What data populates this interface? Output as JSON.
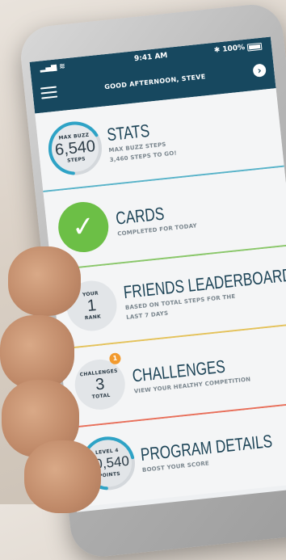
{
  "status_bar": {
    "time": "9:41 AM",
    "battery": "100%"
  },
  "header": {
    "greeting": "GOOD AFTERNOON, STEVE"
  },
  "stats": {
    "badge_top": "MAX BUZZ",
    "badge_value": "6,540",
    "badge_bottom": "STEPS",
    "title": "STATS",
    "sub_1": "MAX BUZZ STEPS",
    "sub_2": "3,460 STEPS TO GO!",
    "progress": 0.65
  },
  "cards": {
    "title": "CARDS",
    "sub": "COMPLETED FOR TODAY"
  },
  "leaderboard": {
    "badge_top": "YOUR",
    "badge_value": "1",
    "badge_bottom": "RANK",
    "title": "FRIENDS LEADERBOARD",
    "sub_1": "BASED ON TOTAL STEPS FOR THE",
    "sub_2": "LAST 7 DAYS"
  },
  "challenges": {
    "badge_top": "CHALLENGES",
    "badge_value": "3",
    "badge_bottom": "TOTAL",
    "notification": "1",
    "title": "CHALLENGES",
    "sub": "VIEW YOUR HEALTHY COMPETITION"
  },
  "program": {
    "badge_top": "LEVEL 4",
    "badge_value": "20,540",
    "badge_bottom": "POINTS",
    "title": "PROGRAM DETAILS",
    "sub": "BOOST YOUR SCORE",
    "progress": 0.7
  },
  "colors": {
    "header": "#17485f",
    "accent_blue": "#2ea3c6",
    "green": "#6cbf46",
    "orange": "#f29a2e",
    "divider_stats": "#58b3c9",
    "divider_cards": "#8ac76a",
    "divider_leaderboard": "#e4c25a",
    "divider_challenges": "#e86f5a"
  }
}
